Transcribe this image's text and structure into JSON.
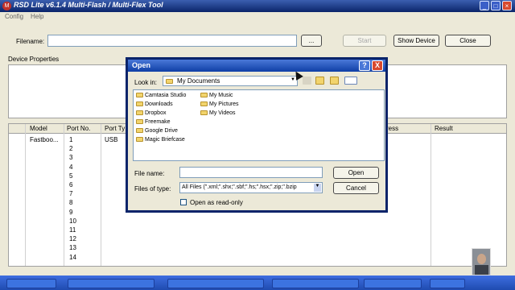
{
  "app": {
    "title": "RSD Lite v6.1.4 Multi-Flash / Multi-Flex Tool",
    "menu": [
      "Config",
      "Help"
    ]
  },
  "toolbar": {
    "filename_label": "Filename:",
    "filename_value": "",
    "browse_label": "...",
    "start_label": "Start",
    "show_device_label": "Show Device",
    "close_label": "Close"
  },
  "device_properties": {
    "label": "Device Properties"
  },
  "grid": {
    "columns": [
      "Model",
      "Port No.",
      "Port Ty",
      "ress",
      "Result"
    ],
    "rows": [
      {
        "model": "Fastboo...",
        "port": "1",
        "type": "USB"
      },
      {
        "model": "",
        "port": "2",
        "type": ""
      },
      {
        "model": "",
        "port": "3",
        "type": ""
      },
      {
        "model": "",
        "port": "4",
        "type": ""
      },
      {
        "model": "",
        "port": "5",
        "type": ""
      },
      {
        "model": "",
        "port": "6",
        "type": ""
      },
      {
        "model": "",
        "port": "7",
        "type": ""
      },
      {
        "model": "",
        "port": "8",
        "type": ""
      },
      {
        "model": "",
        "port": "9",
        "type": ""
      },
      {
        "model": "",
        "port": "10",
        "type": ""
      },
      {
        "model": "",
        "port": "11",
        "type": ""
      },
      {
        "model": "",
        "port": "12",
        "type": ""
      },
      {
        "model": "",
        "port": "13",
        "type": ""
      },
      {
        "model": "",
        "port": "14",
        "type": ""
      }
    ]
  },
  "dialog": {
    "title": "Open",
    "help_label": "?",
    "close_label": "X",
    "look_in_label": "Look in:",
    "look_in_value": "My Documents",
    "items_col1": [
      "Camtasia Studio",
      "Downloads",
      "Dropbox",
      "Freemake",
      "Google Drive",
      "Magic Briefcase"
    ],
    "items_col2": [
      "My Music",
      "My Pictures",
      "My Videos"
    ],
    "file_name_label": "File name:",
    "file_name_value": "",
    "files_of_type_label": "Files of type:",
    "files_of_type_value": "All Files (\".xml;\".shx;\".sbf;\".hs;\".hsx;\".zip;\".bzip",
    "open_label": "Open",
    "cancel_label": "Cancel",
    "read_only_label": "Open as read-only"
  },
  "colors": {
    "titlebar": "#0a246a",
    "window_bg": "#ece9d8",
    "taskbar": "#2a58c8",
    "dialog_close": "#d8492e"
  }
}
